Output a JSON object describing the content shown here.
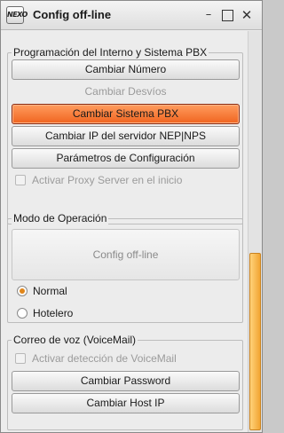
{
  "window": {
    "title": "Config off-line",
    "logo_text": "NEXO",
    "controls": {
      "minimize": "–",
      "close": "✕"
    }
  },
  "groups": {
    "pbx": {
      "title": "Programación del Interno y Sistema PBX",
      "buttons": {
        "cambiar_numero": "Cambiar Número",
        "cambiar_desvios": "Cambiar Desvíos",
        "cambiar_sistema": "Cambiar Sistema PBX",
        "cambiar_ip": "Cambiar IP del servidor NEP|NPS",
        "parametros": "Parámetros de Configuración"
      },
      "proxy_checkbox": {
        "label": "Activar Proxy Server en el inicio",
        "checked": false,
        "enabled": false
      }
    },
    "modo": {
      "title": "Modo de Operación",
      "mode_button": "Config off-line",
      "options": {
        "normal": "Normal",
        "hotelero": "Hotelero"
      },
      "selected": "Normal"
    },
    "voicemail": {
      "title": "Correo de voz (VoiceMail)",
      "detect_checkbox": {
        "label": "Activar detección de VoiceMail",
        "checked": false,
        "enabled": false
      },
      "buttons": {
        "cambiar_password": "Cambiar Password",
        "cambiar_host": "Cambiar Host IP"
      }
    }
  },
  "colors": {
    "accent": "#f0641f",
    "radio_dot": "#e0861b",
    "scroll_thumb": "#f2a533"
  }
}
